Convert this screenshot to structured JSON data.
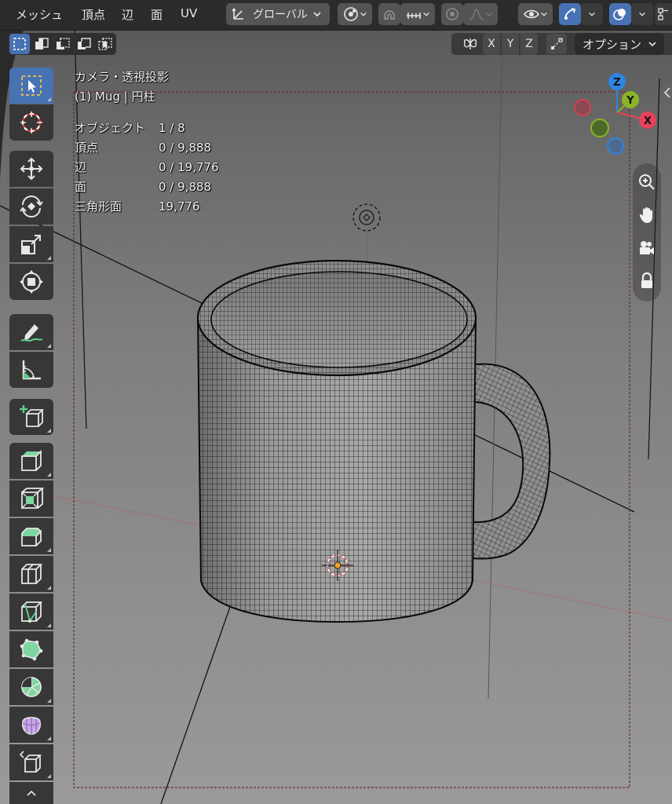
{
  "menu": {
    "items": [
      "メッシュ",
      "頂点",
      "辺",
      "面",
      "UV"
    ]
  },
  "header": {
    "transform_orientation": "グローバル",
    "options_label": "オプション",
    "axis_x": "X",
    "axis_y": "Y",
    "axis_z": "Z"
  },
  "overlay": {
    "view_name": "カメラ・透視投影",
    "object_line": "(1) Mug | 円柱",
    "stats": [
      {
        "label": "オブジェクト",
        "value": "1 / 8"
      },
      {
        "label": "頂点",
        "value": "0 / 9,888"
      },
      {
        "label": "辺",
        "value": "0 / 19,776"
      },
      {
        "label": "面",
        "value": "0 / 9,888"
      },
      {
        "label": "三角形面",
        "value": "19,776"
      }
    ]
  },
  "gizmo": {
    "z_label": "Z",
    "y_label": "Y",
    "x_label": "X",
    "colors": {
      "x": "#e8415a",
      "y": "#8ab527",
      "z": "#2f84e0"
    }
  },
  "icons": {
    "tools": [
      "select-box-icon",
      "cursor-icon",
      "move-icon",
      "rotate-icon",
      "scale-icon",
      "transform-icon",
      "annotate-icon",
      "measure-icon",
      "add-cube-icon",
      "extrude-icon",
      "inset-icon",
      "bevel-icon",
      "loop-cut-icon",
      "knife-icon",
      "poly-build-icon",
      "spin-icon",
      "smooth-icon",
      "shear-icon"
    ],
    "nav": [
      "zoom-icon",
      "pan-hand-icon",
      "camera-icon",
      "lock-icon"
    ]
  },
  "colors": {
    "accent": "#4772b3",
    "header_bg": "#2b2b2b",
    "tool_bg": "#373737"
  }
}
